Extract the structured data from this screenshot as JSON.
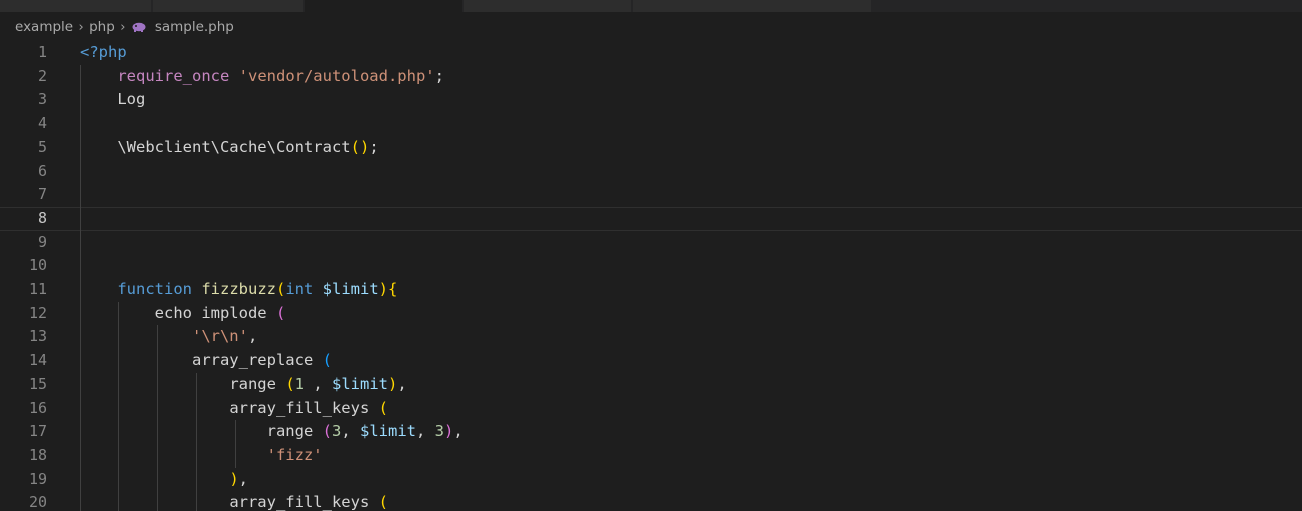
{
  "breadcrumb": {
    "items": [
      "example",
      "php",
      "sample.php"
    ],
    "file_icon": "php-elephant-icon"
  },
  "editor": {
    "current_line": 8,
    "lines": [
      {
        "n": "1",
        "tokens": [
          {
            "t": "<?php",
            "c": "t-tag"
          }
        ]
      },
      {
        "n": "2",
        "tokens": [
          {
            "t": "    ",
            "c": "t-plain"
          },
          {
            "t": "require_once",
            "c": "t-kw"
          },
          {
            "t": " ",
            "c": "t-plain"
          },
          {
            "t": "'vendor/autoload.php'",
            "c": "t-str"
          },
          {
            "t": ";",
            "c": "t-plain"
          }
        ]
      },
      {
        "n": "3",
        "tokens": [
          {
            "t": "    ",
            "c": "t-plain"
          },
          {
            "t": "Log",
            "c": "t-ident"
          }
        ]
      },
      {
        "n": "4",
        "tokens": []
      },
      {
        "n": "5",
        "tokens": [
          {
            "t": "    ",
            "c": "t-plain"
          },
          {
            "t": "\\Webclient\\Cache\\Contract",
            "c": "t-ident"
          },
          {
            "t": "(",
            "c": "t-p1"
          },
          {
            "t": ")",
            "c": "t-p1"
          },
          {
            "t": ";",
            "c": "t-plain"
          }
        ]
      },
      {
        "n": "6",
        "tokens": []
      },
      {
        "n": "7",
        "tokens": []
      },
      {
        "n": "8",
        "tokens": []
      },
      {
        "n": "9",
        "tokens": []
      },
      {
        "n": "10",
        "tokens": []
      },
      {
        "n": "11",
        "tokens": [
          {
            "t": "    ",
            "c": "t-plain"
          },
          {
            "t": "function",
            "c": "t-decl"
          },
          {
            "t": " ",
            "c": "t-plain"
          },
          {
            "t": "fizzbuzz",
            "c": "t-fn"
          },
          {
            "t": "(",
            "c": "t-p1"
          },
          {
            "t": "int",
            "c": "t-decl"
          },
          {
            "t": " ",
            "c": "t-plain"
          },
          {
            "t": "$limit",
            "c": "t-var"
          },
          {
            "t": ")",
            "c": "t-p1"
          },
          {
            "t": "{",
            "c": "t-p1"
          }
        ]
      },
      {
        "n": "12",
        "tokens": [
          {
            "t": "        ",
            "c": "t-plain"
          },
          {
            "t": "echo implode ",
            "c": "t-ident"
          },
          {
            "t": "(",
            "c": "t-p2"
          }
        ]
      },
      {
        "n": "13",
        "tokens": [
          {
            "t": "            ",
            "c": "t-plain"
          },
          {
            "t": "'\\r\\n'",
            "c": "t-str"
          },
          {
            "t": ",",
            "c": "t-plain"
          }
        ]
      },
      {
        "n": "14",
        "tokens": [
          {
            "t": "            ",
            "c": "t-plain"
          },
          {
            "t": "array_replace ",
            "c": "t-ident"
          },
          {
            "t": "(",
            "c": "t-p3"
          }
        ]
      },
      {
        "n": "15",
        "tokens": [
          {
            "t": "                ",
            "c": "t-plain"
          },
          {
            "t": "range ",
            "c": "t-ident"
          },
          {
            "t": "(",
            "c": "t-p1"
          },
          {
            "t": "1",
            "c": "t-num"
          },
          {
            "t": " , ",
            "c": "t-plain"
          },
          {
            "t": "$limit",
            "c": "t-var"
          },
          {
            "t": ")",
            "c": "t-p1"
          },
          {
            "t": ",",
            "c": "t-plain"
          }
        ]
      },
      {
        "n": "16",
        "tokens": [
          {
            "t": "                ",
            "c": "t-plain"
          },
          {
            "t": "array_fill_keys ",
            "c": "t-ident"
          },
          {
            "t": "(",
            "c": "t-p1"
          }
        ]
      },
      {
        "n": "17",
        "tokens": [
          {
            "t": "                    ",
            "c": "t-plain"
          },
          {
            "t": "range ",
            "c": "t-ident"
          },
          {
            "t": "(",
            "c": "t-p2"
          },
          {
            "t": "3",
            "c": "t-num"
          },
          {
            "t": ", ",
            "c": "t-plain"
          },
          {
            "t": "$limit",
            "c": "t-var"
          },
          {
            "t": ", ",
            "c": "t-plain"
          },
          {
            "t": "3",
            "c": "t-num"
          },
          {
            "t": ")",
            "c": "t-p2"
          },
          {
            "t": ",",
            "c": "t-plain"
          }
        ]
      },
      {
        "n": "18",
        "tokens": [
          {
            "t": "                    ",
            "c": "t-plain"
          },
          {
            "t": "'fizz'",
            "c": "t-str"
          }
        ]
      },
      {
        "n": "19",
        "tokens": [
          {
            "t": "                ",
            "c": "t-plain"
          },
          {
            "t": ")",
            "c": "t-p1"
          },
          {
            "t": ",",
            "c": "t-plain"
          }
        ]
      },
      {
        "n": "20",
        "tokens": [
          {
            "t": "                ",
            "c": "t-plain"
          },
          {
            "t": "array_fill_keys ",
            "c": "t-ident"
          },
          {
            "t": "(",
            "c": "t-p1"
          }
        ]
      }
    ]
  }
}
